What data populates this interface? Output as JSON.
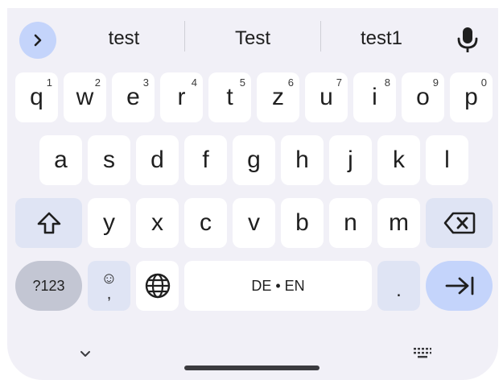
{
  "suggestions": [
    "test",
    "Test",
    "test1"
  ],
  "row1": [
    {
      "label": "q",
      "num": "1"
    },
    {
      "label": "w",
      "num": "2"
    },
    {
      "label": "e",
      "num": "3"
    },
    {
      "label": "r",
      "num": "4"
    },
    {
      "label": "t",
      "num": "5"
    },
    {
      "label": "z",
      "num": "6"
    },
    {
      "label": "u",
      "num": "7"
    },
    {
      "label": "i",
      "num": "8"
    },
    {
      "label": "o",
      "num": "9"
    },
    {
      "label": "p",
      "num": "0"
    }
  ],
  "row2": [
    "a",
    "s",
    "d",
    "f",
    "g",
    "h",
    "j",
    "k",
    "l"
  ],
  "row3": [
    "y",
    "x",
    "c",
    "v",
    "b",
    "n",
    "m"
  ],
  "bottom": {
    "symbols_label": "?123",
    "emoji_top": "☺",
    "emoji_bottom": ",",
    "space_label": "DE • EN",
    "period_label": "."
  },
  "icons": {
    "expand": "chevron-right-icon",
    "mic": "microphone-icon",
    "shift": "shift-icon",
    "backspace": "backspace-icon",
    "globe": "globe-icon",
    "enter": "next-arrow-icon",
    "hide": "chevron-down-icon",
    "switch": "keyboard-icon"
  },
  "colors": {
    "background": "#f1f0f7",
    "key": "#ffffff",
    "modifier_key": "#dfe4f4",
    "symbols_key": "#c3c6d3",
    "accent": "#c4d4fb"
  }
}
